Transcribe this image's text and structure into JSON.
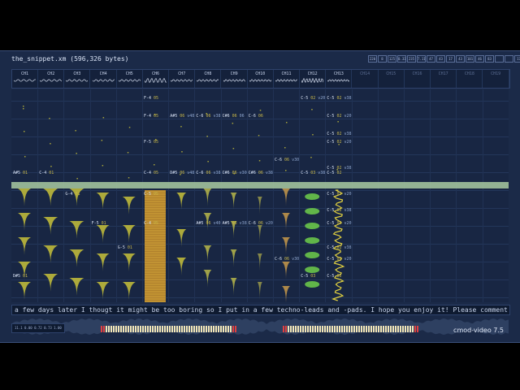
{
  "window": {
    "title": "the_snippet.xm (596,326 bytes)"
  },
  "badges": [
    "220",
    "8",
    "125",
    "0.33",
    "235",
    "7.11",
    "47",
    "43",
    "17",
    "43",
    "101",
    "46",
    "83",
    "",
    "",
    "17",
    "4",
    "20"
  ],
  "channels": [
    "CH1",
    "CH2",
    "CH3",
    "CH4",
    "CH5",
    "CH6",
    "CH7",
    "CH8",
    "CH9",
    "CH10",
    "CH11",
    "CH12",
    "CH13",
    "CH14",
    "CH15",
    "CH16",
    "CH17",
    "CH18",
    "CH19"
  ],
  "active_channels": 13,
  "row_numbers": [
    "18",
    "1C",
    "20",
    "24",
    "28",
    "2C",
    "30",
    "34",
    "38",
    "3C",
    "40",
    "44",
    "48"
  ],
  "notes": [
    {
      "c": 5,
      "row": "F-4",
      "ins": "05",
      "vol": ""
    },
    {
      "c": 11,
      "row": "C-5",
      "ins": "02",
      "vol": "v20"
    },
    {
      "c": 12,
      "row": "C-5",
      "ins": "02",
      "vol": "v38"
    },
    {
      "c": 5,
      "row": "F-4",
      "ins": "05",
      "vol": ""
    },
    {
      "c": 6,
      "row": "A#5",
      "ins": "06",
      "vol": "v48"
    },
    {
      "c": 7,
      "row": "C-6",
      "ins": "06",
      "vol": "v38"
    },
    {
      "c": 8,
      "row": "C#6",
      "ins": "06",
      "vol": "06"
    },
    {
      "c": 9,
      "row": "C-6",
      "ins": "06",
      "vol": ""
    },
    {
      "c": 12,
      "row": "C-5",
      "ins": "02",
      "vol": "v20"
    },
    {
      "c": 12,
      "row": "C-5",
      "ins": "02",
      "vol": "v38"
    },
    {
      "c": 5,
      "row": "F-5",
      "ins": "05",
      "vol": ""
    },
    {
      "c": 12,
      "row": "C-5",
      "ins": "02",
      "vol": "v20"
    },
    {
      "c": 10,
      "row": "C-6",
      "ins": "06",
      "vol": "v30"
    },
    {
      "c": 12,
      "row": "C-5",
      "ins": "02",
      "vol": "v38"
    },
    {
      "c": 0,
      "row": "A#5",
      "ins": "01",
      "vol": ""
    },
    {
      "c": 1,
      "row": "C-4",
      "ins": "01",
      "vol": ""
    },
    {
      "c": 5,
      "row": "C-4",
      "ins": "05",
      "vol": ""
    },
    {
      "c": 6,
      "row": "D#5",
      "ins": "06",
      "vol": "v48"
    },
    {
      "c": 7,
      "row": "C-6",
      "ins": "06",
      "vol": "v38"
    },
    {
      "c": 8,
      "row": "C#6",
      "ins": "06",
      "vol": "v30"
    },
    {
      "c": 9,
      "row": "C#6",
      "ins": "06",
      "vol": "v38"
    },
    {
      "c": 11,
      "row": "C-5",
      "ins": "03",
      "vol": "v38"
    },
    {
      "c": 12,
      "row": "C-5",
      "ins": "02",
      "vol": ""
    },
    {
      "c": 2,
      "row": "G-4",
      "ins": "01",
      "vol": ""
    },
    {
      "c": 5,
      "row": "C-5",
      "ins": "05",
      "vol": ""
    },
    {
      "c": 12,
      "row": "C-5",
      "ins": "02",
      "vol": "v20"
    },
    {
      "c": 12,
      "row": "C-5",
      "ins": "02",
      "vol": "v38"
    },
    {
      "c": 3,
      "row": "F-5",
      "ins": "01",
      "vol": ""
    },
    {
      "c": 5,
      "row": "C-4",
      "ins": "05",
      "vol": ""
    },
    {
      "c": 7,
      "row": "A#5",
      "ins": "06",
      "vol": "v40"
    },
    {
      "c": 8,
      "row": "A#5",
      "ins": "06",
      "vol": "v38"
    },
    {
      "c": 9,
      "row": "C-6",
      "ins": "06",
      "vol": "v20"
    },
    {
      "c": 12,
      "row": "C-5",
      "ins": "02",
      "vol": "v20"
    },
    {
      "c": 4,
      "row": "G-5",
      "ins": "01",
      "vol": ""
    },
    {
      "c": 12,
      "row": "C-5",
      "ins": "02",
      "vol": "v38"
    },
    {
      "c": 10,
      "row": "C-6",
      "ins": "06",
      "vol": "v30"
    },
    {
      "c": 12,
      "row": "C-5",
      "ins": "02",
      "vol": "v20"
    },
    {
      "c": 0,
      "row": "D#5",
      "ins": "01",
      "vol": ""
    },
    {
      "c": 11,
      "row": "C-5",
      "ins": "03",
      "vol": ""
    },
    {
      "c": 12,
      "row": "C-5",
      "ins": "02",
      "vol": ""
    }
  ],
  "ticker": {
    "text": "a few days later I thougt it might be too boring so I put in a few techno-leads and -pads. I hope you enjoy it! Please comment on"
  },
  "timebox": {
    "text": "11.1  0.00  0.72  0.73  1.00"
  },
  "footer": {
    "version": "cmod-video 7.5"
  },
  "colors": {
    "accent": "#a9cba1",
    "wave_yellow": "#c8c23a",
    "wave_green": "#6fcf4a",
    "wave_orange": "#e0a020"
  }
}
